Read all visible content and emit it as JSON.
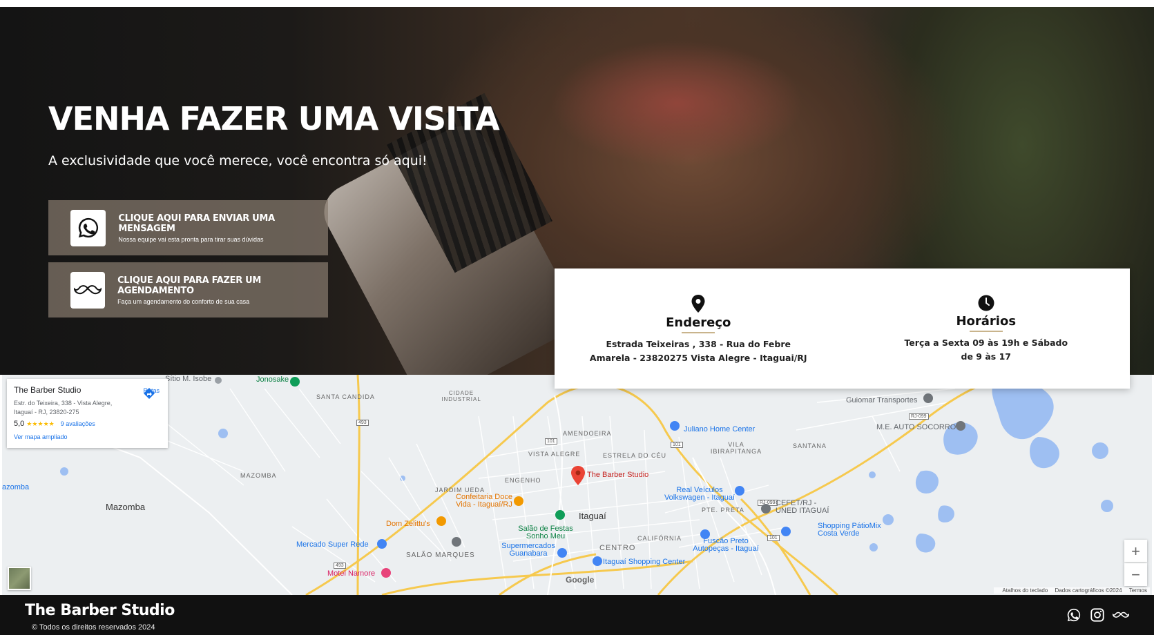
{
  "hero": {
    "title": "VENHA FAZER UMA VISITA",
    "subtitle": "A exclusividade que você merece, você encontra só aqui!",
    "cta_whatsapp": {
      "title": "CLIQUE AQUI PARA ENVIAR UMA MENSAGEM",
      "desc": "Nossa equipe vai esta pronta para tirar suas dúvidas",
      "icon": "whatsapp-icon"
    },
    "cta_booking": {
      "title": "CLIQUE AQUI PARA FAZER UM AGENDAMENTO",
      "desc": "Faça um agendamento do conforto de sua casa",
      "icon": "mustache-icon"
    }
  },
  "info": {
    "address": {
      "title": "Endereço",
      "line1": "Estrada Teixeiras , 338 - Rua do Febre",
      "line2": "Amarela - 23820275 Vista Alegre - Itaguai/RJ",
      "icon": "location-pin-icon"
    },
    "hours": {
      "title": "Horários",
      "line1": "Terça a Sexta 09 às 19h e Sábado",
      "line2": "de 9 às 17",
      "icon": "clock-icon"
    },
    "accent_color": "#c9b48c"
  },
  "map": {
    "card": {
      "name": "The Barber Studio",
      "address": "Estr. do Teixeira, 338 - Vista Alegre, Itaguaí - RJ, 23820-275",
      "rating": "5,0",
      "stars": "★★★★★",
      "reviews": "9 avaliações",
      "larger_map": "Ver mapa ampliado",
      "routes": "Rotas"
    },
    "labels": {
      "sitio": "Sítio M. Isobe",
      "jonosake": "Jonosake",
      "santa_candida": "SANTA CANDIDA",
      "cidade_industrial": "CIDADE INDUSTRIAL",
      "mazomba_upper": "MAZOMBA",
      "mazomba": "Mazomba",
      "azomba": "azomba",
      "amendoeira": "AMENDOEIRA",
      "vista_alegre": "VISTA ALEGRE",
      "estrela_do_ceu": "ESTRELA DO CÉU",
      "vila_ibirapitanga": "VILA IBIRAPITANGA",
      "engenho": "ENGENHO",
      "jardim_ueda": "JARDIM UEDA",
      "barber_studio": "The Barber Studio",
      "juliano": "Juliano Home Center",
      "guiomar": "Guiomar Transportes",
      "me_auto": "M.E. AUTO SOCORRO",
      "santana": "SANTANA",
      "confeitaria": "Confeitaria Doce Vida - Itaguaí/RJ",
      "itaguai": "Itaguaí",
      "real_veiculos": "Real Veículos Volkswagen - Itaguaí",
      "pte_preta": "PTE. PRETA",
      "cefet": "CEFET/RJ - UNED ITAGUAÍ",
      "shopping_patio": "Shopping PátioMix Costa Verde",
      "dom_zelittus": "Dom Zelittu's",
      "salao_festas": "Salão de Festas Sonho Meu",
      "california": "CALIFÓRNIA",
      "centro": "CENTRO",
      "fuscao": "Fuscão Preto Autopeças - Itaguaí",
      "mercado": "Mercado Super Rede",
      "supermercados": "Supermercados Guanabara",
      "salao_marques": "SALÃO MARQUES",
      "itaguai_shopping": "Itaguaí Shopping Center",
      "motel": "Motel Namore",
      "google": "Google"
    },
    "road_shields": [
      "493",
      "101",
      "101",
      "RJ-099",
      "RJ-099",
      "101",
      "493"
    ],
    "zoom_in": "+",
    "zoom_out": "−",
    "attribution": {
      "shortcuts": "Atalhos do teclado",
      "data": "Dados cartográficos ©2024",
      "terms": "Termos"
    }
  },
  "footer": {
    "brand": "The Barber Studio",
    "copyright": "© Todos os direitos reservados 2024",
    "social": [
      "whatsapp-icon",
      "instagram-icon",
      "mustache-icon"
    ]
  }
}
